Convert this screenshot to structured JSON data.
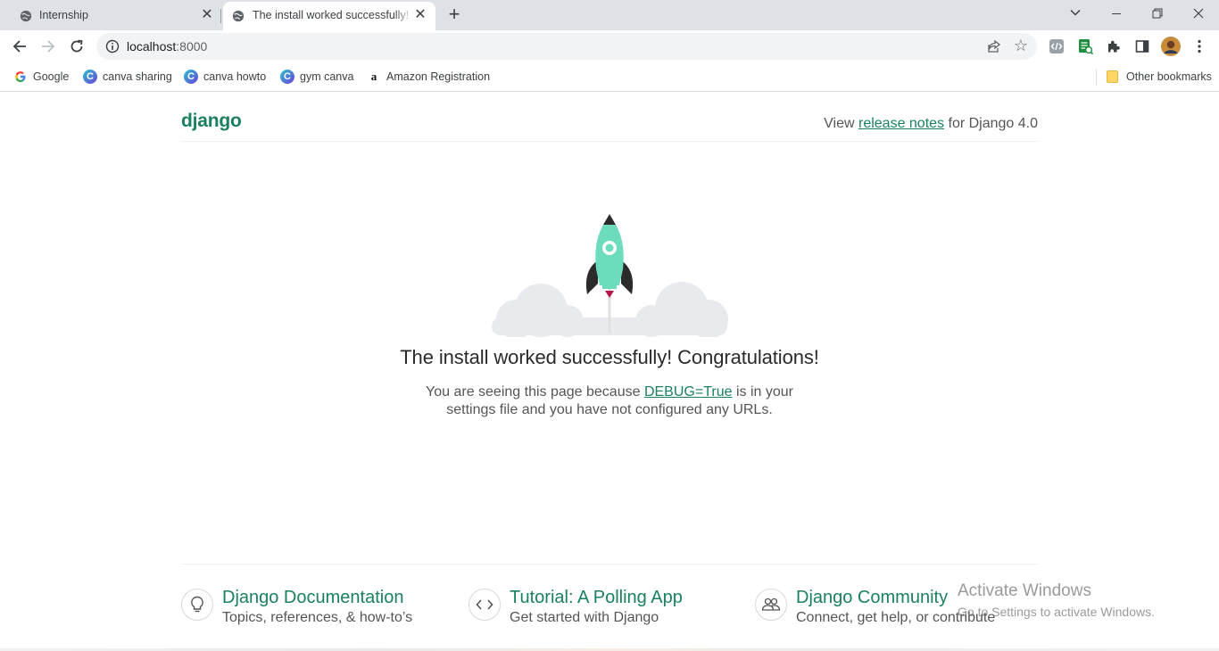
{
  "browser": {
    "tabs": [
      {
        "title": "Internship",
        "active": false
      },
      {
        "title": "The install worked successfully! Congratulations!",
        "active": true
      }
    ],
    "url": {
      "host": "localhost",
      "port": ":8000"
    },
    "bookmarks": [
      {
        "label": "Google",
        "icon": "google-icon"
      },
      {
        "label": "canva sharing",
        "icon": "canva-icon"
      },
      {
        "label": "canva howto",
        "icon": "canva-icon"
      },
      {
        "label": "gym canva",
        "icon": "canva-icon"
      },
      {
        "label": "Amazon Registration",
        "icon": "amazon-icon"
      }
    ],
    "other_bookmarks": "Other bookmarks"
  },
  "django": {
    "logo": "django",
    "notes_prefix": "View ",
    "notes_link": "release notes",
    "notes_suffix": " for Django 4.0",
    "headline": "The install worked successfully! Congratulations!",
    "sub_line1_prefix": "You are seeing this page because ",
    "sub_line1_link": "DEBUG=True",
    "sub_line1_suffix": " is in your",
    "sub_line2": "settings file and you have not configured any URLs.",
    "cards": [
      {
        "title": "Django Documentation",
        "subtitle": "Topics, references, & how-to’s",
        "icon": "lightbulb-icon"
      },
      {
        "title": "Tutorial: A Polling App",
        "subtitle": "Get started with Django",
        "icon": "code-icon"
      },
      {
        "title": "Django Community",
        "subtitle": "Connect, get help, or contribute",
        "icon": "people-icon"
      }
    ]
  },
  "watermark": {
    "line1": "Activate Windows",
    "line2": "Go to Settings to activate Windows."
  },
  "colors": {
    "django_green": "#1a8060",
    "rocket_mint": "#6ddcbd",
    "tab_strip": "#dee1e6"
  }
}
